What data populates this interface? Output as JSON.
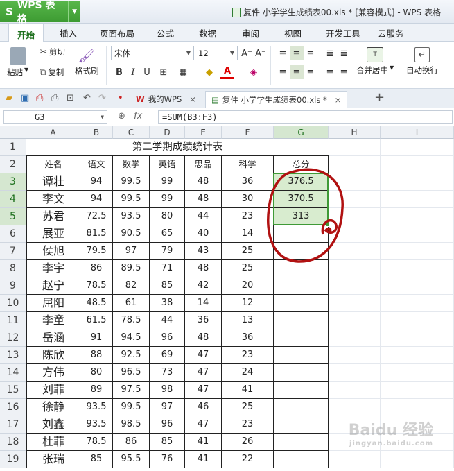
{
  "app": {
    "name": "WPS 表格",
    "logo": "S"
  },
  "window_title": "复件 小学学生成绩表00.xls * [兼容模式] - WPS 表格",
  "menu": [
    "开始",
    "插入",
    "页面布局",
    "公式",
    "数据",
    "审阅",
    "视图",
    "开发工具",
    "云服务"
  ],
  "ribbon": {
    "paste": "粘贴",
    "cut": "剪切",
    "copy": "复制",
    "format_painter": "格式刷",
    "font_name": "宋体",
    "font_size": "12",
    "merge_center": "合并居中",
    "wrap_text": "自动换行"
  },
  "doc_tabs": [
    {
      "label": "我的WPS"
    },
    {
      "label": "复件 小学学生成绩表00.xls *"
    }
  ],
  "formula_bar": {
    "cell_ref": "G3",
    "fx": "fx",
    "formula": "=SUM(B3:F3)"
  },
  "columns": [
    "A",
    "B",
    "C",
    "D",
    "E",
    "F",
    "G",
    "H",
    "I"
  ],
  "sheet": {
    "title": "第二学期成绩统计表",
    "headers": [
      "姓名",
      "语文",
      "数学",
      "英语",
      "思品",
      "科学",
      "总分"
    ],
    "rows": [
      [
        "谭壮",
        "94",
        "99.5",
        "99",
        "48",
        "36",
        "376.5"
      ],
      [
        "李文",
        "94",
        "99.5",
        "99",
        "48",
        "30",
        "370.5"
      ],
      [
        "苏君",
        "72.5",
        "93.5",
        "80",
        "44",
        "23",
        "313"
      ],
      [
        "展亚",
        "81.5",
        "90.5",
        "65",
        "40",
        "14",
        ""
      ],
      [
        "侯旭",
        "79.5",
        "97",
        "79",
        "43",
        "25",
        ""
      ],
      [
        "李宇",
        "86",
        "89.5",
        "71",
        "48",
        "25",
        ""
      ],
      [
        "赵宁",
        "78.5",
        "82",
        "85",
        "42",
        "20",
        ""
      ],
      [
        "屈阳",
        "48.5",
        "61",
        "38",
        "14",
        "12",
        ""
      ],
      [
        "李童",
        "61.5",
        "78.5",
        "44",
        "36",
        "13",
        ""
      ],
      [
        "岳涵",
        "91",
        "94.5",
        "96",
        "48",
        "36",
        ""
      ],
      [
        "陈欣",
        "88",
        "92.5",
        "69",
        "47",
        "23",
        ""
      ],
      [
        "方伟",
        "80",
        "96.5",
        "73",
        "47",
        "24",
        ""
      ],
      [
        "刘菲",
        "89",
        "97.5",
        "98",
        "47",
        "41",
        ""
      ],
      [
        "徐静",
        "93.5",
        "99.5",
        "97",
        "46",
        "25",
        ""
      ],
      [
        "刘鑫",
        "93.5",
        "98.5",
        "96",
        "47",
        "23",
        ""
      ],
      [
        "杜菲",
        "78.5",
        "86",
        "85",
        "41",
        "26",
        ""
      ],
      [
        "张瑞",
        "85",
        "95.5",
        "76",
        "41",
        "22",
        ""
      ]
    ]
  },
  "watermark": {
    "text": "Baidu 经验",
    "sub": "jingyan.baidu.com"
  },
  "colors": {
    "accent": "#3f9a37",
    "annotation": "#b11111"
  }
}
